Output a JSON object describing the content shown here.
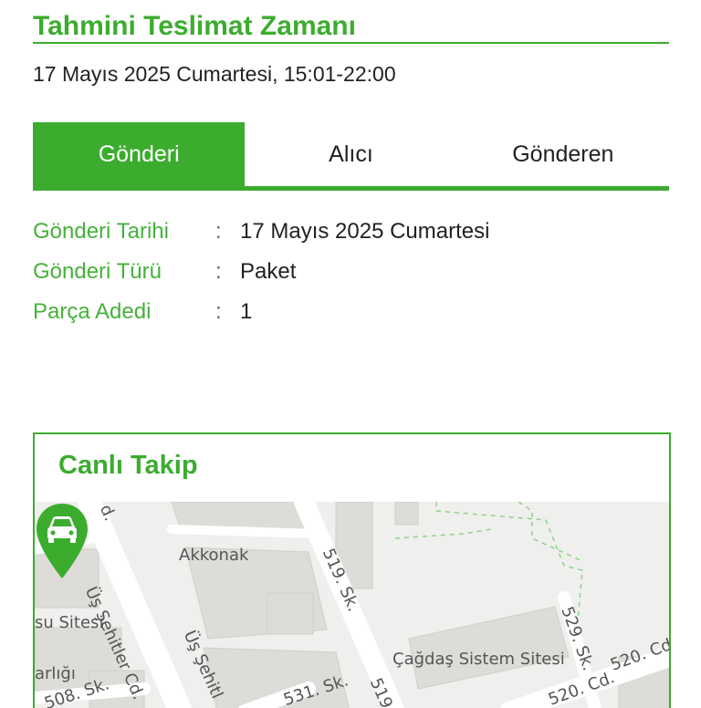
{
  "header": {
    "title": "Tahmini Teslimat Zamanı",
    "delivery_time": "17 Mayıs 2025 Cumartesi, 15:01-22:00"
  },
  "tabs": [
    {
      "label": "Gönderi",
      "active": true
    },
    {
      "label": "Alıcı",
      "active": false
    },
    {
      "label": "Gönderen",
      "active": false
    }
  ],
  "shipment": {
    "rows": [
      {
        "label": "Gönderi Tarihi",
        "separator": ":",
        "value": "17 Mayıs 2025 Cumartesi"
      },
      {
        "label": "Gönderi Türü",
        "separator": ":",
        "value": "Paket"
      },
      {
        "label": "Parça Adedi",
        "separator": ":",
        "value": "1"
      }
    ]
  },
  "tracking": {
    "title": "Canlı Takip",
    "map_labels": {
      "akkonak": "Akkonak",
      "us_sehitler": "Üş Şehitler Cd.",
      "us_sehitler_2": "Üş Şehitl",
      "su_sitesi": "su Sitesi",
      "arligi": "arlığı",
      "sk_508": "508. Sk.",
      "sk_519": "519. Sk.",
      "sk_519b": "519",
      "sk_529": "529. Sk.",
      "cagdas": "Çağdaş Sistem Sitesi",
      "cd_520": "520. Cd.",
      "cd_520b": "520. Cd.",
      "sk_531": "531. Sk.",
      "cd_d": "d."
    },
    "pin_icon": "car-icon"
  },
  "colors": {
    "brand": "#3cac2f",
    "map_bg": "#efefed",
    "building": "#dedcd8",
    "road": "#ffffff"
  }
}
